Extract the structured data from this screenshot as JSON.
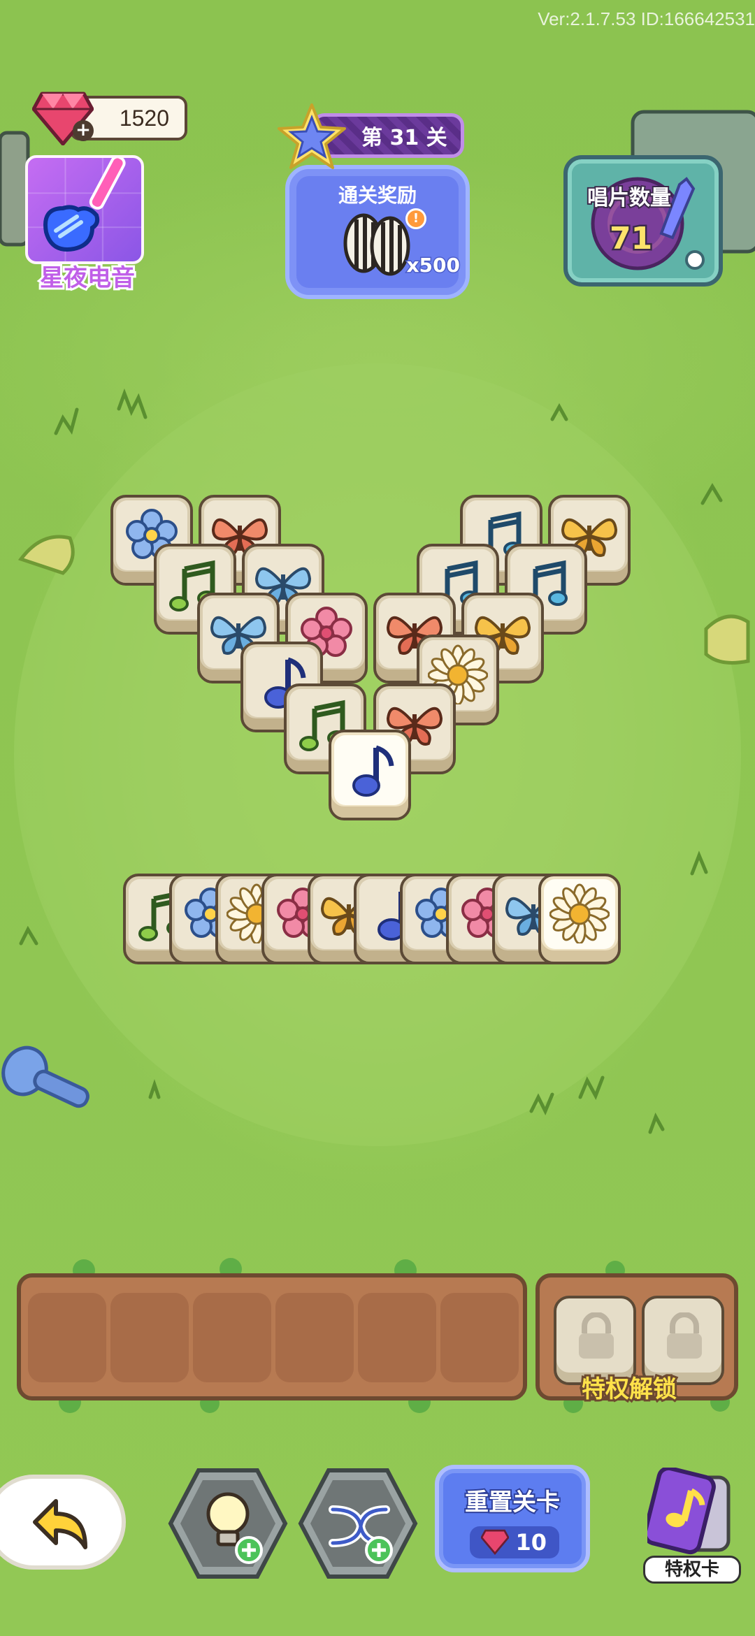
{
  "header": {
    "version_text": "Ver:2.1.7.53 ID:166642531",
    "gems": "1520",
    "guitar_event_label": "星夜电音",
    "level_label": "第 31 关",
    "reward": {
      "title": "通关奖励",
      "count": "x500",
      "info": "!"
    },
    "records": {
      "title": "唱片数量",
      "count": "71"
    }
  },
  "board": {
    "tiles": [
      {
        "icon": "blue-flower",
        "layer": "under"
      },
      {
        "icon": "red-butterfly",
        "layer": "under"
      },
      {
        "icon": "green-note",
        "layer": "under"
      },
      {
        "icon": "blue-butterfly",
        "layer": "under"
      },
      {
        "icon": "blue-butterfly",
        "layer": "under"
      },
      {
        "icon": "pink-flower",
        "layer": "under"
      },
      {
        "icon": "blue-note",
        "layer": "under"
      },
      {
        "icon": "green-note",
        "layer": "under"
      },
      {
        "icon": "teal-note",
        "layer": "under"
      },
      {
        "icon": "yellow-butterfly",
        "layer": "under"
      },
      {
        "icon": "teal-note",
        "layer": "under"
      },
      {
        "icon": "teal-note",
        "layer": "under"
      },
      {
        "icon": "red-butterfly",
        "layer": "under"
      },
      {
        "icon": "yellow-butterfly",
        "layer": "under"
      },
      {
        "icon": "daisy",
        "layer": "under"
      },
      {
        "icon": "red-butterfly",
        "layer": "under"
      },
      {
        "icon": "blue-note",
        "layer": "top"
      }
    ],
    "stack_row": [
      "green-note",
      "blue-flower",
      "daisy",
      "pink-flower",
      "yellow-butterfly",
      "blue-note",
      "blue-flower",
      "pink-flower",
      "blue-butterfly",
      "daisy"
    ]
  },
  "tray": {
    "slots": 6,
    "locked_slots": 2,
    "lock_label": "特权解锁"
  },
  "controls": {
    "undo_icon": "undo-arrow-icon",
    "hint_icon": "lightbulb-icon",
    "shuffle_icon": "shuffle-icon",
    "reset_title": "重置关卡",
    "reset_cost": "10",
    "privilege_card_label": "特权卡"
  },
  "colors": {
    "grass": "#8fc451",
    "accent_blue": "#5d7df0",
    "gem": "#e8466e",
    "lock_label": "#ffe24a"
  }
}
